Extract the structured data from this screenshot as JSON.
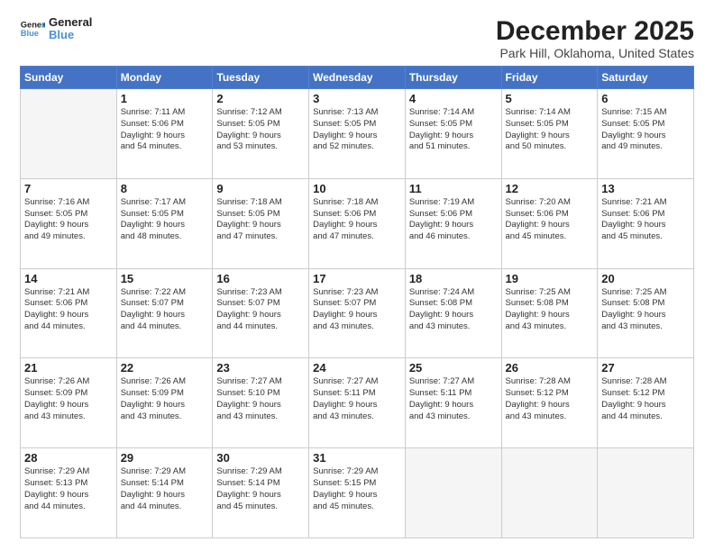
{
  "logo": {
    "line1": "General",
    "line2": "Blue"
  },
  "title": "December 2025",
  "subtitle": "Park Hill, Oklahoma, United States",
  "weekdays": [
    "Sunday",
    "Monday",
    "Tuesday",
    "Wednesday",
    "Thursday",
    "Friday",
    "Saturday"
  ],
  "weeks": [
    [
      {
        "day": "",
        "info": ""
      },
      {
        "day": "1",
        "info": "Sunrise: 7:11 AM\nSunset: 5:06 PM\nDaylight: 9 hours\nand 54 minutes."
      },
      {
        "day": "2",
        "info": "Sunrise: 7:12 AM\nSunset: 5:05 PM\nDaylight: 9 hours\nand 53 minutes."
      },
      {
        "day": "3",
        "info": "Sunrise: 7:13 AM\nSunset: 5:05 PM\nDaylight: 9 hours\nand 52 minutes."
      },
      {
        "day": "4",
        "info": "Sunrise: 7:14 AM\nSunset: 5:05 PM\nDaylight: 9 hours\nand 51 minutes."
      },
      {
        "day": "5",
        "info": "Sunrise: 7:14 AM\nSunset: 5:05 PM\nDaylight: 9 hours\nand 50 minutes."
      },
      {
        "day": "6",
        "info": "Sunrise: 7:15 AM\nSunset: 5:05 PM\nDaylight: 9 hours\nand 49 minutes."
      }
    ],
    [
      {
        "day": "7",
        "info": "Sunrise: 7:16 AM\nSunset: 5:05 PM\nDaylight: 9 hours\nand 49 minutes."
      },
      {
        "day": "8",
        "info": "Sunrise: 7:17 AM\nSunset: 5:05 PM\nDaylight: 9 hours\nand 48 minutes."
      },
      {
        "day": "9",
        "info": "Sunrise: 7:18 AM\nSunset: 5:05 PM\nDaylight: 9 hours\nand 47 minutes."
      },
      {
        "day": "10",
        "info": "Sunrise: 7:18 AM\nSunset: 5:06 PM\nDaylight: 9 hours\nand 47 minutes."
      },
      {
        "day": "11",
        "info": "Sunrise: 7:19 AM\nSunset: 5:06 PM\nDaylight: 9 hours\nand 46 minutes."
      },
      {
        "day": "12",
        "info": "Sunrise: 7:20 AM\nSunset: 5:06 PM\nDaylight: 9 hours\nand 45 minutes."
      },
      {
        "day": "13",
        "info": "Sunrise: 7:21 AM\nSunset: 5:06 PM\nDaylight: 9 hours\nand 45 minutes."
      }
    ],
    [
      {
        "day": "14",
        "info": "Sunrise: 7:21 AM\nSunset: 5:06 PM\nDaylight: 9 hours\nand 44 minutes."
      },
      {
        "day": "15",
        "info": "Sunrise: 7:22 AM\nSunset: 5:07 PM\nDaylight: 9 hours\nand 44 minutes."
      },
      {
        "day": "16",
        "info": "Sunrise: 7:23 AM\nSunset: 5:07 PM\nDaylight: 9 hours\nand 44 minutes."
      },
      {
        "day": "17",
        "info": "Sunrise: 7:23 AM\nSunset: 5:07 PM\nDaylight: 9 hours\nand 43 minutes."
      },
      {
        "day": "18",
        "info": "Sunrise: 7:24 AM\nSunset: 5:08 PM\nDaylight: 9 hours\nand 43 minutes."
      },
      {
        "day": "19",
        "info": "Sunrise: 7:25 AM\nSunset: 5:08 PM\nDaylight: 9 hours\nand 43 minutes."
      },
      {
        "day": "20",
        "info": "Sunrise: 7:25 AM\nSunset: 5:08 PM\nDaylight: 9 hours\nand 43 minutes."
      }
    ],
    [
      {
        "day": "21",
        "info": "Sunrise: 7:26 AM\nSunset: 5:09 PM\nDaylight: 9 hours\nand 43 minutes."
      },
      {
        "day": "22",
        "info": "Sunrise: 7:26 AM\nSunset: 5:09 PM\nDaylight: 9 hours\nand 43 minutes."
      },
      {
        "day": "23",
        "info": "Sunrise: 7:27 AM\nSunset: 5:10 PM\nDaylight: 9 hours\nand 43 minutes."
      },
      {
        "day": "24",
        "info": "Sunrise: 7:27 AM\nSunset: 5:11 PM\nDaylight: 9 hours\nand 43 minutes."
      },
      {
        "day": "25",
        "info": "Sunrise: 7:27 AM\nSunset: 5:11 PM\nDaylight: 9 hours\nand 43 minutes."
      },
      {
        "day": "26",
        "info": "Sunrise: 7:28 AM\nSunset: 5:12 PM\nDaylight: 9 hours\nand 43 minutes."
      },
      {
        "day": "27",
        "info": "Sunrise: 7:28 AM\nSunset: 5:12 PM\nDaylight: 9 hours\nand 44 minutes."
      }
    ],
    [
      {
        "day": "28",
        "info": "Sunrise: 7:29 AM\nSunset: 5:13 PM\nDaylight: 9 hours\nand 44 minutes."
      },
      {
        "day": "29",
        "info": "Sunrise: 7:29 AM\nSunset: 5:14 PM\nDaylight: 9 hours\nand 44 minutes."
      },
      {
        "day": "30",
        "info": "Sunrise: 7:29 AM\nSunset: 5:14 PM\nDaylight: 9 hours\nand 45 minutes."
      },
      {
        "day": "31",
        "info": "Sunrise: 7:29 AM\nSunset: 5:15 PM\nDaylight: 9 hours\nand 45 minutes."
      },
      {
        "day": "",
        "info": ""
      },
      {
        "day": "",
        "info": ""
      },
      {
        "day": "",
        "info": ""
      }
    ]
  ]
}
